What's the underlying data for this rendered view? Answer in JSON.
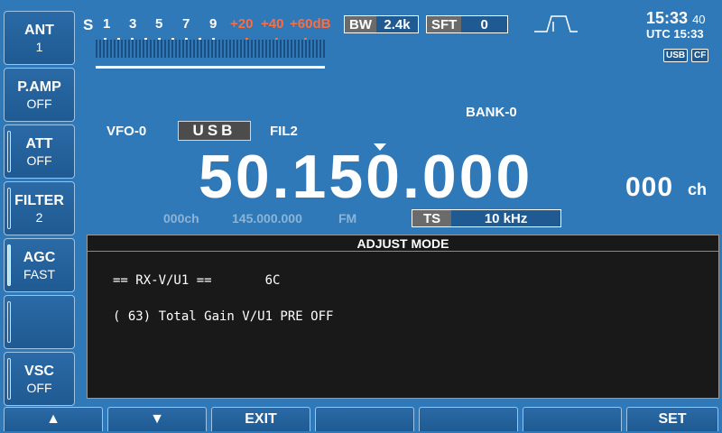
{
  "side_buttons": [
    {
      "title": "ANT",
      "value": "1"
    },
    {
      "title": "P.AMP",
      "value": "OFF"
    },
    {
      "title": "ATT",
      "value": "OFF"
    },
    {
      "title": "FILTER",
      "value": "2"
    },
    {
      "title": "AGC",
      "value": "FAST"
    },
    {
      "title": "",
      "value": ""
    },
    {
      "title": "VSC",
      "value": "OFF"
    }
  ],
  "bottom_buttons": [
    "▲",
    "▼",
    "EXIT",
    "",
    "",
    "",
    "SET"
  ],
  "meter": {
    "s_label": "S",
    "scale": [
      "1",
      "3",
      "5",
      "7",
      "9",
      "+20",
      "+40",
      "+60dB"
    ]
  },
  "bw": {
    "label": "BW",
    "value": "2.4k"
  },
  "sft": {
    "label": "SFT",
    "value": "0"
  },
  "clock": {
    "time": "15:33",
    "seconds": "40",
    "utc_label": "UTC",
    "utc_time": "15:33"
  },
  "tags": [
    "USB",
    "CF"
  ],
  "bank": "BANK-0",
  "vfo": "VFO-0",
  "mode": "USB",
  "filter": "FIL2",
  "frequency": "50.150.000",
  "channel": {
    "number": "000",
    "suffix": "ch"
  },
  "sub": {
    "channel": "000ch",
    "frequency": "145.000.000",
    "mode": "FM"
  },
  "ts": {
    "label": "TS",
    "value": "10 kHz"
  },
  "adjust": {
    "title": "ADJUST  MODE",
    "line1": "== RX-V/U1 ==       6C",
    "line2": "( 63) Total Gain V/U1 PRE OFF"
  },
  "colors": {
    "background": "#2f79b8",
    "panel": "#191919",
    "scale_red": "#ff6b3d"
  }
}
